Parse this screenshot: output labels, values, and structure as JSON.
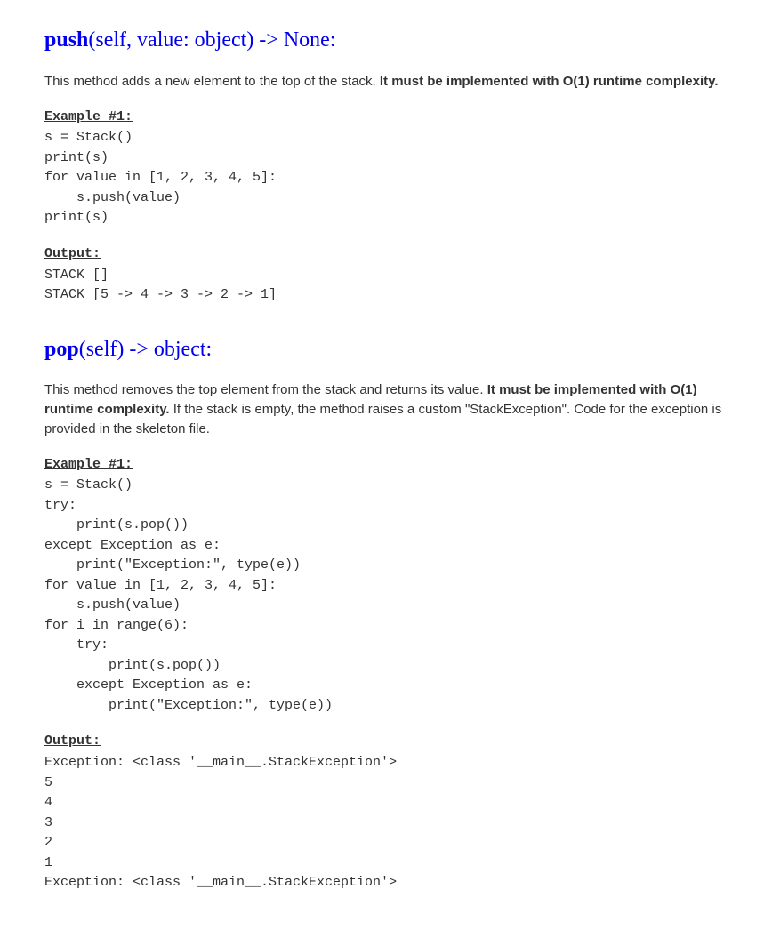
{
  "push": {
    "heading_name": "push",
    "heading_sig": "(self, value: object) -> None:",
    "desc_pre": "This method adds a new element to the top of the stack. ",
    "desc_bold": "It must be implemented with O(1) runtime complexity.",
    "example_label": "Example #1:",
    "example_code": "s = Stack()\nprint(s)\nfor value in [1, 2, 3, 4, 5]:\n    s.push(value)\nprint(s)",
    "output_label": "Output:",
    "output_code": "STACK []\nSTACK [5 -> 4 -> 3 -> 2 -> 1]"
  },
  "pop": {
    "heading_name": "pop",
    "heading_sig": "(self) -> object:",
    "desc_pre": "This method removes the top element from the stack and returns its value. ",
    "desc_bold": "It must be implemented with O(1) runtime complexity.",
    "desc_post": " If the stack is empty, the method raises a custom \"StackException\". Code for the exception is provided in the skeleton file.",
    "example_label": "Example #1:",
    "example_code": "s = Stack()\ntry:\n    print(s.pop())\nexcept Exception as e:\n    print(\"Exception:\", type(e))\nfor value in [1, 2, 3, 4, 5]:\n    s.push(value)\nfor i in range(6):\n    try:\n        print(s.pop())\n    except Exception as e:\n        print(\"Exception:\", type(e))",
    "output_label": "Output:",
    "output_code": "Exception: <class '__main__.StackException'>\n5\n4\n3\n2\n1\nException: <class '__main__.StackException'>"
  }
}
